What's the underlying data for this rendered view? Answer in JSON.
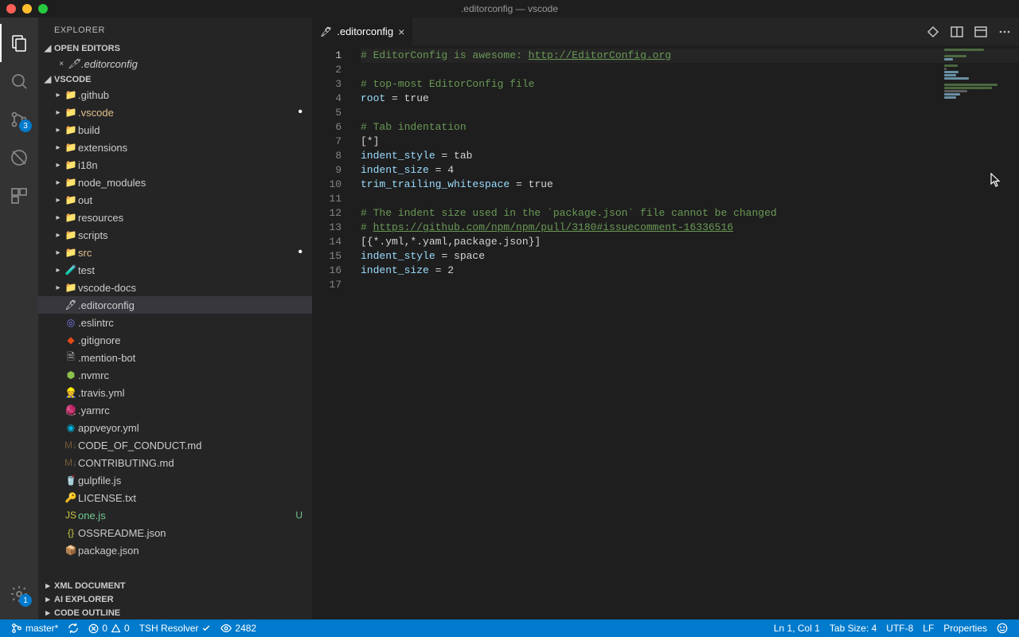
{
  "window": {
    "title": ".editorconfig — vscode"
  },
  "activity": {
    "scm_badge": "3",
    "settings_badge": "1"
  },
  "sidebar": {
    "title": "EXPLORER",
    "open_editors_label": "OPEN EDITORS",
    "workspace_label": "VSCODE",
    "open_editors": [
      {
        "label": ".editorconfig"
      }
    ],
    "tree": [
      {
        "label": ".github",
        "kind": "folder",
        "depth": 1
      },
      {
        "label": ".vscode",
        "kind": "folder",
        "depth": 1,
        "modified": true,
        "dot": true
      },
      {
        "label": "build",
        "kind": "folder",
        "depth": 1
      },
      {
        "label": "extensions",
        "kind": "folder",
        "depth": 1
      },
      {
        "label": "i18n",
        "kind": "folder",
        "depth": 1
      },
      {
        "label": "node_modules",
        "kind": "folder",
        "depth": 1
      },
      {
        "label": "out",
        "kind": "folder",
        "depth": 1
      },
      {
        "label": "resources",
        "kind": "folder",
        "depth": 1
      },
      {
        "label": "scripts",
        "kind": "folder",
        "depth": 1
      },
      {
        "label": "src",
        "kind": "folder",
        "depth": 1,
        "modified": true,
        "dot": true
      },
      {
        "label": "test",
        "kind": "folder",
        "depth": 1
      },
      {
        "label": "vscode-docs",
        "kind": "folder",
        "depth": 1
      },
      {
        "label": ".editorconfig",
        "kind": "file",
        "depth": 1,
        "selected": true
      },
      {
        "label": ".eslintrc",
        "kind": "file",
        "depth": 1
      },
      {
        "label": ".gitignore",
        "kind": "file",
        "depth": 1
      },
      {
        "label": ".mention-bot",
        "kind": "file",
        "depth": 1
      },
      {
        "label": ".nvmrc",
        "kind": "file",
        "depth": 1
      },
      {
        "label": ".travis.yml",
        "kind": "file",
        "depth": 1
      },
      {
        "label": ".yarnrc",
        "kind": "file",
        "depth": 1
      },
      {
        "label": "appveyor.yml",
        "kind": "file",
        "depth": 1
      },
      {
        "label": "CODE_OF_CONDUCT.md",
        "kind": "file",
        "depth": 1
      },
      {
        "label": "CONTRIBUTING.md",
        "kind": "file",
        "depth": 1
      },
      {
        "label": "gulpfile.js",
        "kind": "file",
        "depth": 1
      },
      {
        "label": "LICENSE.txt",
        "kind": "file",
        "depth": 1
      },
      {
        "label": "one.js",
        "kind": "file",
        "depth": 1,
        "untracked": true,
        "badge": "U"
      },
      {
        "label": "OSSREADME.json",
        "kind": "file",
        "depth": 1
      },
      {
        "label": "package.json",
        "kind": "file",
        "depth": 1
      }
    ],
    "collapsed_sections": [
      {
        "label": "XML DOCUMENT"
      },
      {
        "label": "AI EXPLORER"
      },
      {
        "label": "CODE OUTLINE"
      }
    ]
  },
  "editor": {
    "tab_label": ".editorconfig",
    "lines": [
      {
        "n": 1,
        "cur": true,
        "tokens": [
          {
            "t": "# EditorConfig is awesome: ",
            "c": "comment"
          },
          {
            "t": "http://EditorConfig.org",
            "c": "link"
          }
        ]
      },
      {
        "n": 2,
        "tokens": []
      },
      {
        "n": 3,
        "tokens": [
          {
            "t": "# top-most EditorConfig file",
            "c": "comment"
          }
        ]
      },
      {
        "n": 4,
        "tokens": [
          {
            "t": "root",
            "c": "key"
          },
          {
            "t": " = ",
            "c": "op"
          },
          {
            "t": "true",
            "c": "val"
          }
        ]
      },
      {
        "n": 5,
        "tokens": []
      },
      {
        "n": 6,
        "tokens": [
          {
            "t": "# Tab indentation",
            "c": "comment"
          }
        ]
      },
      {
        "n": 7,
        "tokens": [
          {
            "t": "[*]",
            "c": "section"
          }
        ]
      },
      {
        "n": 8,
        "tokens": [
          {
            "t": "indent_style",
            "c": "key"
          },
          {
            "t": " = ",
            "c": "op"
          },
          {
            "t": "tab",
            "c": "val"
          }
        ]
      },
      {
        "n": 9,
        "tokens": [
          {
            "t": "indent_size",
            "c": "key"
          },
          {
            "t": " = ",
            "c": "op"
          },
          {
            "t": "4",
            "c": "val"
          }
        ]
      },
      {
        "n": 10,
        "tokens": [
          {
            "t": "trim_trailing_whitespace",
            "c": "key"
          },
          {
            "t": " = ",
            "c": "op"
          },
          {
            "t": "true",
            "c": "val"
          }
        ]
      },
      {
        "n": 11,
        "tokens": []
      },
      {
        "n": 12,
        "tokens": [
          {
            "t": "# The indent size used in the `package.json` file cannot be changed",
            "c": "comment"
          }
        ]
      },
      {
        "n": 13,
        "tokens": [
          {
            "t": "# ",
            "c": "comment"
          },
          {
            "t": "https://github.com/npm/npm/pull/3180#issuecomment-16336516",
            "c": "link"
          }
        ]
      },
      {
        "n": 14,
        "tokens": [
          {
            "t": "[{*.yml,*.yaml,package.json}]",
            "c": "section"
          }
        ]
      },
      {
        "n": 15,
        "tokens": [
          {
            "t": "indent_style",
            "c": "key"
          },
          {
            "t": " = ",
            "c": "op"
          },
          {
            "t": "space",
            "c": "val"
          }
        ]
      },
      {
        "n": 16,
        "tokens": [
          {
            "t": "indent_size",
            "c": "key"
          },
          {
            "t": " = ",
            "c": "op"
          },
          {
            "t": "2",
            "c": "val"
          }
        ]
      },
      {
        "n": 17,
        "tokens": []
      }
    ]
  },
  "status": {
    "branch": "master*",
    "errors": "0",
    "warnings": "0",
    "resolver": "TSH Resolver",
    "views": "2482",
    "cursor": "Ln 1, Col 1",
    "tabsize": "Tab Size: 4",
    "encoding": "UTF-8",
    "eol": "LF",
    "language": "Properties"
  },
  "icons": {
    "files": {
      ".github": {
        "g": "",
        "bg": "#24292e",
        "fg": "#fff"
      },
      ".vscode": {
        "g": "📁",
        "bg": "#0065a9",
        "fg": "#fff"
      },
      "build": {
        "g": "📁",
        "bg": "#c09553"
      },
      "extensions": {
        "g": "📁",
        "bg": "#c09553"
      },
      "i18n": {
        "g": "📁",
        "bg": "#3b8686"
      },
      "node_modules": {
        "g": "📁",
        "bg": "#8bc34a"
      },
      "out": {
        "g": "📁",
        "bg": "#c09553"
      },
      "resources": {
        "g": "📁",
        "bg": "#c09553"
      },
      "scripts": {
        "g": "📁",
        "bg": "#c09553"
      },
      "src": {
        "g": "📁",
        "bg": "#4caf50"
      },
      "test": {
        "g": "🧪",
        "bg": "#e53935"
      },
      "vscode-docs": {
        "g": "📁",
        "bg": "#c09553"
      },
      ".editorconfig": {
        "g": "🖋",
        "fg": "#e0e0e0"
      },
      ".eslintrc": {
        "g": "◎",
        "fg": "#8080f2"
      },
      ".gitignore": {
        "g": "◆",
        "fg": "#e64a19"
      },
      ".mention-bot": {
        "g": "🗎",
        "fg": "#c5c5c5"
      },
      ".nvmrc": {
        "g": "⬢",
        "fg": "#8bc34a"
      },
      ".travis.yml": {
        "g": "👷",
        "fg": "#c5a332"
      },
      ".yarnrc": {
        "g": "🧶",
        "fg": "#2c8ebb"
      },
      "appveyor.yml": {
        "g": "◉",
        "fg": "#00b3e0"
      },
      "CODE_OF_CONDUCT.md": {
        "g": "M↓",
        "fg": "#755838"
      },
      "CONTRIBUTING.md": {
        "g": "M↓",
        "fg": "#755838"
      },
      "gulpfile.js": {
        "g": "🥤",
        "fg": "#cf4647"
      },
      "LICENSE.txt": {
        "g": "🔑",
        "fg": "#d4af37"
      },
      "one.js": {
        "g": "JS",
        "fg": "#cbcb41"
      },
      "OSSREADME.json": {
        "g": "{}",
        "fg": "#cbcb41"
      },
      "package.json": {
        "g": "📦",
        "fg": "#8bc34a"
      }
    }
  }
}
